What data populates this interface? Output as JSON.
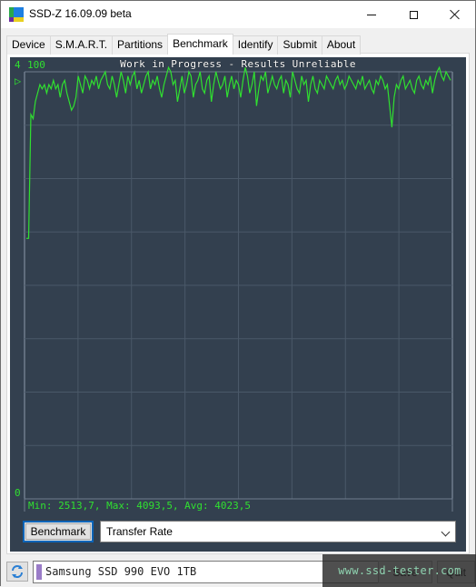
{
  "window": {
    "title": "SSD-Z 16.09.09 beta",
    "icon": "ssdz-app-icon",
    "controls": [
      "minimize",
      "maximize",
      "close"
    ]
  },
  "tabs": [
    {
      "label": "Device",
      "active": false
    },
    {
      "label": "S.M.A.R.T.",
      "active": false
    },
    {
      "label": "Partitions",
      "active": false
    },
    {
      "label": "Benchmark",
      "active": true
    },
    {
      "label": "Identify",
      "active": false
    },
    {
      "label": "Submit",
      "active": false
    },
    {
      "label": "About",
      "active": false
    }
  ],
  "benchmark": {
    "corner_label": "4",
    "marker_glyph": "▷",
    "stats_text": "Min: 2513,7, Max: 4093,5, Avg: 4023,5",
    "run_button": "Benchmark",
    "mode_select": {
      "value": "Transfer Rate"
    }
  },
  "chart_data": {
    "type": "line",
    "title": "Work in Progress - Results Unreliable",
    "xlabel": "",
    "ylabel": "",
    "y_tick_labels": {
      "top": "100",
      "bottom": "0"
    },
    "ylim": [
      0,
      100
    ],
    "grid": {
      "on": true,
      "rows": 8,
      "cols": 8
    },
    "line_color": "#30e030",
    "series": [
      {
        "name": "Transfer Rate (%)",
        "values": [
          61,
          61,
          90,
          89,
          93,
          95,
          97,
          96,
          97,
          95,
          97,
          96,
          98,
          96,
          97,
          94,
          97,
          98,
          95,
          93,
          91,
          92,
          94,
          99,
          97,
          95,
          99,
          98,
          96,
          98,
          97,
          99,
          96,
          98,
          99,
          100,
          97,
          96,
          99,
          97,
          94,
          97,
          100,
          98,
          95,
          99,
          97,
          99,
          100,
          96,
          98,
          95,
          97,
          99,
          100,
          96,
          98,
          97,
          99,
          96,
          94,
          97,
          99,
          101,
          100,
          97,
          98,
          93,
          96,
          99,
          95,
          97,
          100,
          99,
          94,
          97,
          98,
          100,
          96,
          95,
          98,
          99,
          93,
          97,
          100,
          98,
          96,
          97,
          99,
          94,
          97,
          99,
          96,
          98,
          97,
          94,
          98,
          101,
          99,
          95,
          97,
          100,
          92,
          96,
          99,
          98,
          100,
          95,
          97,
          99,
          97,
          96,
          98,
          99,
          95,
          98,
          97,
          94,
          100,
          98,
          96,
          95,
          99,
          97,
          98,
          93,
          97,
          99,
          96,
          95,
          98,
          97,
          96,
          99,
          98,
          97,
          96,
          98,
          99,
          97,
          98,
          96,
          97,
          99,
          98,
          97,
          96,
          98,
          97,
          99,
          96,
          97,
          98,
          96,
          95,
          98,
          97,
          99,
          98,
          96,
          97,
          92,
          87,
          94,
          97,
          96,
          98,
          99,
          96,
          97,
          98,
          96,
          95,
          98,
          99,
          97,
          96,
          98,
          97,
          99,
          95,
          98,
          100,
          101,
          99,
          98,
          100,
          99,
          98
        ]
      }
    ]
  },
  "statusbar": {
    "refresh_icon": "refresh-icon",
    "drive_name": "Samsung SSD 990 EVO 1TB",
    "drive_color": "#9a7cc8",
    "button_1": "Save",
    "button_2": "Quit"
  },
  "watermark": {
    "text": "www.ssd-tester.com"
  }
}
